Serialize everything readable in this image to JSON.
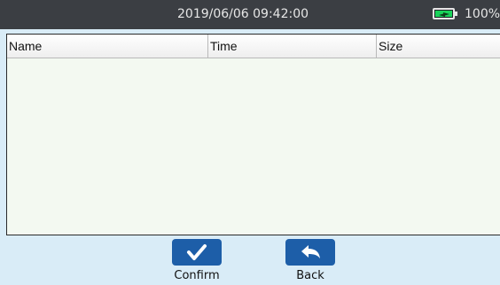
{
  "status_bar": {
    "datetime": "2019/06/06 09:42:00",
    "battery_text": "100%",
    "battery_icon": "battery-charging-icon",
    "battery_color": "#19d35a"
  },
  "file_table": {
    "columns": [
      "Name",
      "Time",
      "Size"
    ],
    "rows": []
  },
  "toolbar": {
    "confirm_label": "Confirm",
    "confirm_icon": "checkmark-icon",
    "back_label": "Back",
    "back_icon": "back-arrow-icon",
    "button_color": "#1d5ea8"
  },
  "colors": {
    "status_bar_bg": "#3b3e43",
    "screen_bg": "#d9ecf7",
    "table_bg": "#f3f9f1"
  }
}
